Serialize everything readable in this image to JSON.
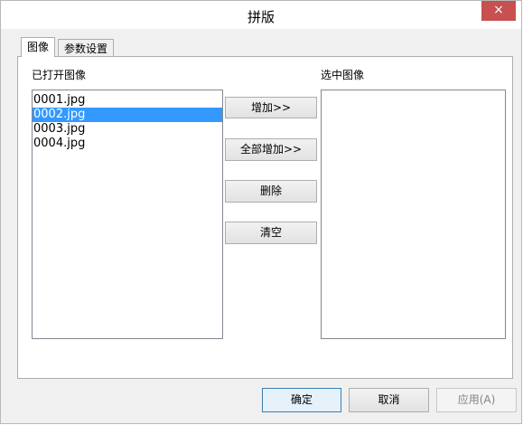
{
  "window": {
    "title": "拼版",
    "close_label": "×"
  },
  "tabs": [
    {
      "label": "图像",
      "active": true
    },
    {
      "label": "参数设置",
      "active": false
    }
  ],
  "left_panel": {
    "label": "已打开图像",
    "items": [
      "0001.jpg",
      "0002.jpg",
      "0003.jpg",
      "0004.jpg"
    ],
    "selected_index": 1
  },
  "right_panel": {
    "label": "选中图像",
    "items": []
  },
  "middle_buttons": {
    "add": "增加>>",
    "add_all": "全部增加>>",
    "delete": "删除",
    "clear": "清空"
  },
  "footer": {
    "ok": "确定",
    "cancel": "取消",
    "apply": "应用(A)"
  },
  "colors": {
    "selection": "#3399ff",
    "close_button": "#c75050"
  }
}
